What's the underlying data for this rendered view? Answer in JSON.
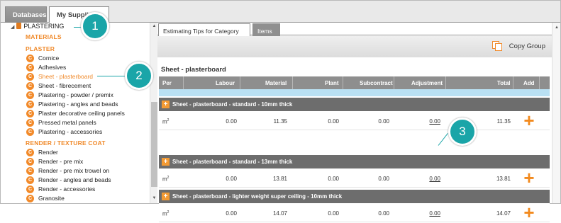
{
  "top_tabs": [
    {
      "label": "Databases"
    },
    {
      "label": "My Suppliers"
    }
  ],
  "tree": {
    "root_label": "PLASTERING",
    "materials_heading": "MATERIALS",
    "plaster_heading": "PLASTER",
    "plaster_items": [
      "Cornice",
      "Adhesives",
      "Sheet - plasterboard",
      "Sheet - fibrecement",
      "Plastering - powder / premix",
      "Plastering - angles and beads",
      "Plaster decorative ceiling panels",
      "Pressed metal panels",
      "Plastering - accessories"
    ],
    "render_heading": "RENDER / TEXTURE COAT",
    "render_items": [
      "Render",
      "Render - pre mix",
      "Render - pre mix trowel on",
      "Render - angles and beads",
      "Render - accessories",
      "Granosite"
    ],
    "bullet_glyph": "C"
  },
  "inner_tabs": [
    {
      "label": "Estimating Tips for Category"
    },
    {
      "label": "Items"
    }
  ],
  "toolbar": {
    "copy_group_label": "Copy Group"
  },
  "section_title": "Sheet - plasterboard",
  "columns": [
    "Per",
    "Labour",
    "Material",
    "Plant",
    "Subcontract",
    "Adjustment",
    "Total",
    "Add"
  ],
  "groups": [
    {
      "label": "Sheet - plasterboard - standard - 10mm thick",
      "unit": "m",
      "unit_sup": "2",
      "labour": "0.00",
      "material": "11.35",
      "plant": "0.00",
      "subcontract": "0.00",
      "adjustment": "0.00",
      "total": "11.35"
    },
    {
      "label": "Sheet - plasterboard - standard - 13mm thick",
      "unit": "m",
      "unit_sup": "2",
      "labour": "0.00",
      "material": "13.81",
      "plant": "0.00",
      "subcontract": "0.00",
      "adjustment": "0.00",
      "total": "13.81"
    },
    {
      "label": "Sheet - plasterboard - lighter weight super ceiling - 10mm thick",
      "unit": "m",
      "unit_sup": "2",
      "labour": "0.00",
      "material": "14.07",
      "plant": "0.00",
      "subcontract": "0.00",
      "adjustment": "0.00",
      "total": "14.07"
    }
  ],
  "add_glyph": "+",
  "callouts": [
    "1",
    "2",
    "3"
  ],
  "colors": {
    "accent_orange": "#f08a2b",
    "callout_teal": "#1aa5a8",
    "header_grey": "#8e8e8e",
    "group_grey": "#6d6d6d",
    "highlight_blue": "#b9e0f3"
  }
}
